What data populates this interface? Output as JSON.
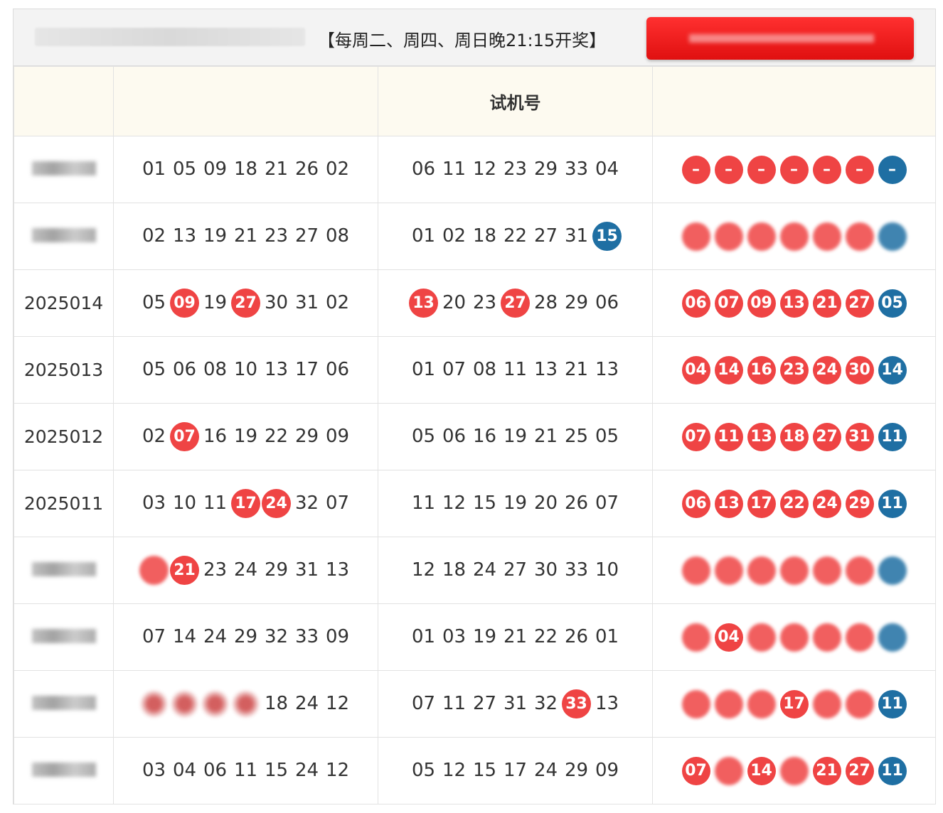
{
  "header": {
    "schedule_note": "【每周二、周四、周日晚21:15开奖】"
  },
  "table": {
    "columns": [
      "",
      "",
      "试机号",
      ""
    ],
    "rows": [
      {
        "issue": "",
        "issue_hidden": true,
        "draw": [
          {
            "v": "01"
          },
          {
            "v": "05"
          },
          {
            "v": "09"
          },
          {
            "v": "18"
          },
          {
            "v": "21"
          },
          {
            "v": "26"
          },
          {
            "v": "02"
          }
        ],
        "test": [
          {
            "v": "06"
          },
          {
            "v": "11"
          },
          {
            "v": "12"
          },
          {
            "v": "23"
          },
          {
            "v": "29"
          },
          {
            "v": "33"
          },
          {
            "v": "04"
          }
        ],
        "balls": [
          {
            "v": "–",
            "c": "r"
          },
          {
            "v": "–",
            "c": "r"
          },
          {
            "v": "–",
            "c": "r"
          },
          {
            "v": "–",
            "c": "r"
          },
          {
            "v": "–",
            "c": "r"
          },
          {
            "v": "–",
            "c": "r"
          },
          {
            "v": "–",
            "c": "b"
          }
        ]
      },
      {
        "issue": "",
        "issue_hidden": true,
        "draw": [
          {
            "v": "02"
          },
          {
            "v": "13"
          },
          {
            "v": "19"
          },
          {
            "v": "21"
          },
          {
            "v": "23"
          },
          {
            "v": "27"
          },
          {
            "v": "08"
          }
        ],
        "test": [
          {
            "v": "01"
          },
          {
            "v": "02"
          },
          {
            "v": "18"
          },
          {
            "v": "22"
          },
          {
            "v": "27"
          },
          {
            "v": "31"
          },
          {
            "v": "15",
            "hl": "blue"
          }
        ],
        "balls": [
          {
            "v": "",
            "c": "r",
            "blur": true
          },
          {
            "v": "",
            "c": "r",
            "blur": true
          },
          {
            "v": "",
            "c": "r",
            "blur": true
          },
          {
            "v": "",
            "c": "r",
            "blur": true
          },
          {
            "v": "",
            "c": "r",
            "blur": true
          },
          {
            "v": "",
            "c": "r",
            "blur": true
          },
          {
            "v": "",
            "c": "b",
            "blur": true
          }
        ]
      },
      {
        "issue": "2025014",
        "draw": [
          {
            "v": "05"
          },
          {
            "v": "09",
            "hl": "red"
          },
          {
            "v": "19"
          },
          {
            "v": "27",
            "hl": "red"
          },
          {
            "v": "30"
          },
          {
            "v": "31"
          },
          {
            "v": "02"
          }
        ],
        "test": [
          {
            "v": "13",
            "hl": "red"
          },
          {
            "v": "20"
          },
          {
            "v": "23"
          },
          {
            "v": "27",
            "hl": "red"
          },
          {
            "v": "28"
          },
          {
            "v": "29"
          },
          {
            "v": "06"
          }
        ],
        "balls": [
          {
            "v": "06",
            "c": "r"
          },
          {
            "v": "07",
            "c": "r"
          },
          {
            "v": "09",
            "c": "r"
          },
          {
            "v": "13",
            "c": "r"
          },
          {
            "v": "21",
            "c": "r"
          },
          {
            "v": "27",
            "c": "r"
          },
          {
            "v": "05",
            "c": "b"
          }
        ]
      },
      {
        "issue": "2025013",
        "draw": [
          {
            "v": "05"
          },
          {
            "v": "06"
          },
          {
            "v": "08"
          },
          {
            "v": "10"
          },
          {
            "v": "13"
          },
          {
            "v": "17"
          },
          {
            "v": "06"
          }
        ],
        "test": [
          {
            "v": "01"
          },
          {
            "v": "07"
          },
          {
            "v": "08"
          },
          {
            "v": "11"
          },
          {
            "v": "13"
          },
          {
            "v": "21"
          },
          {
            "v": "13"
          }
        ],
        "balls": [
          {
            "v": "04",
            "c": "r"
          },
          {
            "v": "14",
            "c": "r"
          },
          {
            "v": "16",
            "c": "r"
          },
          {
            "v": "23",
            "c": "r"
          },
          {
            "v": "24",
            "c": "r"
          },
          {
            "v": "30",
            "c": "r"
          },
          {
            "v": "14",
            "c": "b"
          }
        ]
      },
      {
        "issue": "2025012",
        "draw": [
          {
            "v": "02"
          },
          {
            "v": "07",
            "hl": "red"
          },
          {
            "v": "16"
          },
          {
            "v": "19"
          },
          {
            "v": "22"
          },
          {
            "v": "29"
          },
          {
            "v": "09"
          }
        ],
        "test": [
          {
            "v": "05"
          },
          {
            "v": "06"
          },
          {
            "v": "16"
          },
          {
            "v": "19"
          },
          {
            "v": "21"
          },
          {
            "v": "25"
          },
          {
            "v": "05"
          }
        ],
        "balls": [
          {
            "v": "07",
            "c": "r"
          },
          {
            "v": "11",
            "c": "r"
          },
          {
            "v": "13",
            "c": "r"
          },
          {
            "v": "18",
            "c": "r"
          },
          {
            "v": "27",
            "c": "r"
          },
          {
            "v": "31",
            "c": "r"
          },
          {
            "v": "11",
            "c": "b"
          }
        ]
      },
      {
        "issue": "2025011",
        "draw": [
          {
            "v": "03"
          },
          {
            "v": "10"
          },
          {
            "v": "11"
          },
          {
            "v": "17",
            "hl": "red"
          },
          {
            "v": "24",
            "hl": "red"
          },
          {
            "v": "32"
          },
          {
            "v": "07"
          }
        ],
        "test": [
          {
            "v": "11"
          },
          {
            "v": "12"
          },
          {
            "v": "15"
          },
          {
            "v": "19"
          },
          {
            "v": "20"
          },
          {
            "v": "26"
          },
          {
            "v": "07"
          }
        ],
        "balls": [
          {
            "v": "06",
            "c": "r"
          },
          {
            "v": "13",
            "c": "r"
          },
          {
            "v": "17",
            "c": "r"
          },
          {
            "v": "22",
            "c": "r"
          },
          {
            "v": "24",
            "c": "r"
          },
          {
            "v": "29",
            "c": "r"
          },
          {
            "v": "11",
            "c": "b"
          }
        ]
      },
      {
        "issue": "",
        "issue_hidden": true,
        "draw": [
          {
            "v": "",
            "hl": "red",
            "blur": true
          },
          {
            "v": "21",
            "hl": "red"
          },
          {
            "v": "23"
          },
          {
            "v": "24"
          },
          {
            "v": "29"
          },
          {
            "v": "31"
          },
          {
            "v": "13"
          }
        ],
        "test": [
          {
            "v": "12"
          },
          {
            "v": "18"
          },
          {
            "v": "24"
          },
          {
            "v": "27"
          },
          {
            "v": "30"
          },
          {
            "v": "33"
          },
          {
            "v": "10"
          }
        ],
        "balls": [
          {
            "v": "",
            "c": "r",
            "blur": true
          },
          {
            "v": "",
            "c": "r",
            "blur": true
          },
          {
            "v": "",
            "c": "r",
            "blur": true
          },
          {
            "v": "",
            "c": "r",
            "blur": true
          },
          {
            "v": "",
            "c": "r",
            "blur": true
          },
          {
            "v": "",
            "c": "r",
            "blur": true
          },
          {
            "v": "",
            "c": "b",
            "blur": true
          }
        ]
      },
      {
        "issue": "",
        "issue_hidden": true,
        "draw": [
          {
            "v": "07"
          },
          {
            "v": "14"
          },
          {
            "v": "24"
          },
          {
            "v": "29"
          },
          {
            "v": "32"
          },
          {
            "v": "33"
          },
          {
            "v": "09"
          }
        ],
        "test": [
          {
            "v": "01"
          },
          {
            "v": "03"
          },
          {
            "v": "19"
          },
          {
            "v": "21"
          },
          {
            "v": "22"
          },
          {
            "v": "26"
          },
          {
            "v": "01"
          }
        ],
        "balls": [
          {
            "v": "",
            "c": "r",
            "blur": true
          },
          {
            "v": "04",
            "c": "r"
          },
          {
            "v": "",
            "c": "r",
            "blur": true
          },
          {
            "v": "",
            "c": "r",
            "blur": true
          },
          {
            "v": "",
            "c": "r",
            "blur": true
          },
          {
            "v": "",
            "c": "r",
            "blur": true
          },
          {
            "v": "",
            "c": "b",
            "blur": true
          }
        ]
      },
      {
        "issue": "",
        "issue_hidden": true,
        "draw": [
          {
            "v": "",
            "blur": true
          },
          {
            "v": "",
            "blur": true
          },
          {
            "v": "",
            "blur": true
          },
          {
            "v": "",
            "blur": true
          },
          {
            "v": "18"
          },
          {
            "v": "24"
          },
          {
            "v": "12"
          }
        ],
        "test": [
          {
            "v": "07"
          },
          {
            "v": "11"
          },
          {
            "v": "27"
          },
          {
            "v": "31"
          },
          {
            "v": "32"
          },
          {
            "v": "33",
            "hl": "red"
          },
          {
            "v": "13"
          }
        ],
        "balls": [
          {
            "v": "",
            "c": "r",
            "blur": true
          },
          {
            "v": "",
            "c": "r",
            "blur": true
          },
          {
            "v": "",
            "c": "r",
            "blur": true
          },
          {
            "v": "17",
            "c": "r"
          },
          {
            "v": "",
            "c": "r",
            "blur": true
          },
          {
            "v": "",
            "c": "r",
            "blur": true
          },
          {
            "v": "11",
            "c": "b"
          }
        ]
      },
      {
        "issue": "",
        "issue_hidden": true,
        "draw": [
          {
            "v": "03"
          },
          {
            "v": "04"
          },
          {
            "v": "06"
          },
          {
            "v": "11"
          },
          {
            "v": "15"
          },
          {
            "v": "24"
          },
          {
            "v": "12"
          }
        ],
        "test": [
          {
            "v": "05"
          },
          {
            "v": "12"
          },
          {
            "v": "15"
          },
          {
            "v": "17"
          },
          {
            "v": "24"
          },
          {
            "v": "29"
          },
          {
            "v": "09"
          }
        ],
        "balls": [
          {
            "v": "07",
            "c": "r"
          },
          {
            "v": "",
            "c": "r",
            "blur": true
          },
          {
            "v": "14",
            "c": "r"
          },
          {
            "v": "",
            "c": "r",
            "blur": true
          },
          {
            "v": "21",
            "c": "r"
          },
          {
            "v": "27",
            "c": "r"
          },
          {
            "v": "11",
            "c": "b"
          }
        ]
      }
    ]
  },
  "colors": {
    "red_ball": "#ef4444",
    "blue_ball": "#1f6fa3",
    "header_bg": "#fdfaf0",
    "button_red": "#ff2a2a"
  }
}
